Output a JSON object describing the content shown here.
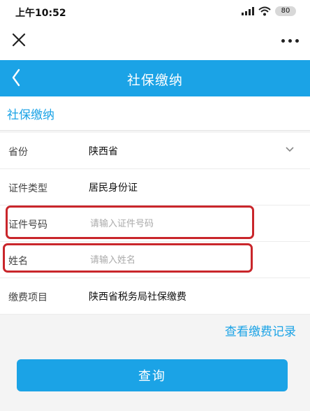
{
  "status": {
    "time": "上午10:52",
    "battery": "80"
  },
  "header": {
    "title": "社保缴纳"
  },
  "section": {
    "title": "社保缴纳"
  },
  "form": {
    "province": {
      "label": "省份",
      "value": "陕西省"
    },
    "id_type": {
      "label": "证件类型",
      "value": "居民身份证"
    },
    "id_number": {
      "label": "证件号码",
      "placeholder": "请输入证件号码"
    },
    "name": {
      "label": "姓名",
      "placeholder": "请输入姓名"
    },
    "fee_item": {
      "label": "缴费项目",
      "value": "陕西省税务局社保缴费"
    }
  },
  "actions": {
    "records_link": "查看缴费记录",
    "query_button": "查询"
  },
  "colors": {
    "brand": "#1ba3e6",
    "highlight": "#c9262b"
  },
  "icons": [
    "signal-icon",
    "wifi-icon",
    "battery-icon",
    "close-icon",
    "more-icon",
    "back-icon",
    "chevron-down-icon"
  ]
}
